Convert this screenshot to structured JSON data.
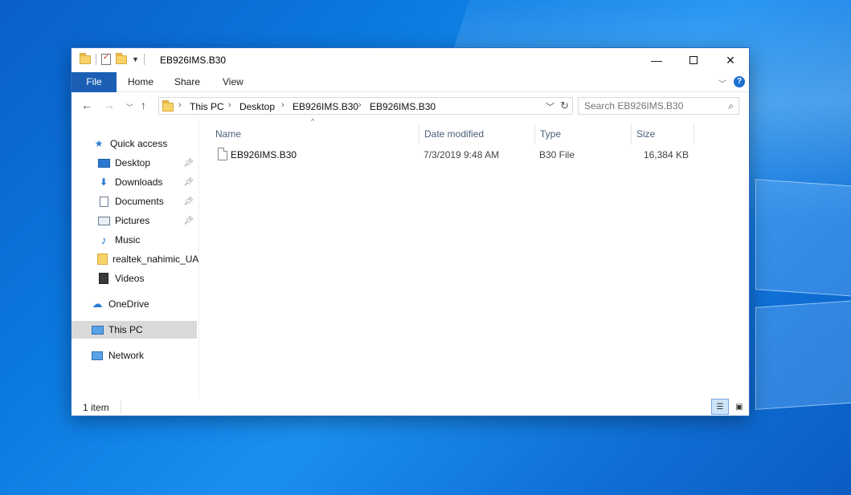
{
  "window": {
    "title": "EB926IMS.B30",
    "caption": {
      "minimize": "—",
      "close": "✕"
    }
  },
  "ribbon": {
    "tabs": [
      "File",
      "Home",
      "Share",
      "View"
    ],
    "help": "?"
  },
  "address": {
    "crumbs": [
      "This PC",
      "Desktop",
      "EB926IMS.B30",
      "EB926IMS.B30"
    ]
  },
  "search": {
    "placeholder": "Search EB926IMS.B30"
  },
  "sidebar": {
    "items": [
      {
        "label": "Quick access",
        "icon": "star-icon"
      },
      {
        "label": "Desktop",
        "icon": "desktop-icon",
        "pinned": true
      },
      {
        "label": "Downloads",
        "icon": "download-arrow-icon",
        "pinned": true
      },
      {
        "label": "Documents",
        "icon": "document-icon",
        "pinned": true
      },
      {
        "label": "Pictures",
        "icon": "pictures-icon",
        "pinned": true
      },
      {
        "label": "Music",
        "icon": "music-note-icon"
      },
      {
        "label": "realtek_nahimic_UA",
        "icon": "folder-icon"
      },
      {
        "label": "Videos",
        "icon": "film-icon"
      },
      {
        "label": "OneDrive",
        "icon": "cloud-icon"
      },
      {
        "label": "This PC",
        "icon": "computer-icon",
        "selected": true
      },
      {
        "label": "Network",
        "icon": "network-icon"
      }
    ]
  },
  "columns": [
    "Name",
    "Date modified",
    "Type",
    "Size"
  ],
  "files": [
    {
      "name": "EB926IMS.B30",
      "date": "7/3/2019 9:48 AM",
      "type": "B30 File",
      "size": "16,384 KB"
    }
  ],
  "status": {
    "count": "1 item"
  },
  "colors": {
    "accent": "#1a5fb4",
    "selection": "#d9d9d9"
  }
}
